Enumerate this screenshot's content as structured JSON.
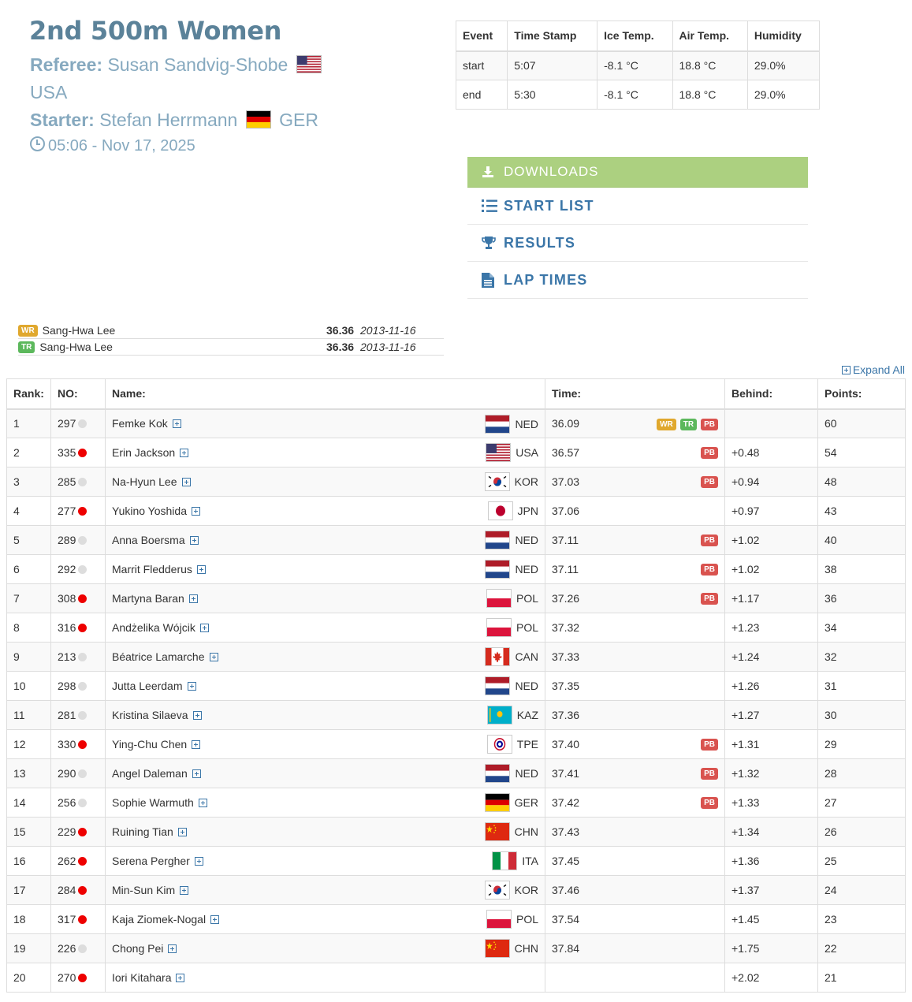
{
  "event": {
    "title": "2nd 500m Women",
    "referee_label": "Referee:",
    "referee_name": "Susan Sandvig-Shobe",
    "referee_country": "USA",
    "starter_label": "Starter:",
    "starter_name": "Stefan Herrmann",
    "starter_country": "GER",
    "datetime": "05:06 - Nov 17, 2025"
  },
  "conditions": {
    "headers": [
      "Event",
      "Time Stamp",
      "Ice Temp.",
      "Air Temp.",
      "Humidity"
    ],
    "rows": [
      [
        "start",
        "5:07",
        "-8.1 °C",
        "18.8 °C",
        "29.0%"
      ],
      [
        "end",
        "5:30",
        "-8.1 °C",
        "18.8 °C",
        "29.0%"
      ]
    ]
  },
  "downloads": {
    "title": "DOWNLOADS",
    "items": [
      {
        "label": "START LIST",
        "icon": "list-ol-icon"
      },
      {
        "label": "RESULTS",
        "icon": "trophy-icon"
      },
      {
        "label": "LAP TIMES",
        "icon": "document-icon"
      }
    ]
  },
  "records": [
    {
      "badge": "WR",
      "name": "Sang-Hwa Lee",
      "time": "36.36",
      "date": "2013-11-16"
    },
    {
      "badge": "TR",
      "name": "Sang-Hwa Lee",
      "time": "36.36",
      "date": "2013-11-16"
    }
  ],
  "expand_all_label": "Expand All",
  "results": {
    "headers": {
      "rank": "Rank:",
      "no": "NO:",
      "name": "Name:",
      "time": "Time:",
      "behind": "Behind:",
      "points": "Points:"
    },
    "rows": [
      {
        "rank": "1",
        "no": "297",
        "dot": "grey",
        "name": "Femke Kok",
        "nat": "NED",
        "time": "36.09",
        "badges": [
          "WR",
          "TR",
          "PB"
        ],
        "behind": "",
        "points": "60"
      },
      {
        "rank": "2",
        "no": "335",
        "dot": "red",
        "name": "Erin Jackson",
        "nat": "USA",
        "time": "36.57",
        "badges": [
          "PB"
        ],
        "behind": "+0.48",
        "points": "54"
      },
      {
        "rank": "3",
        "no": "285",
        "dot": "grey",
        "name": "Na-Hyun Lee",
        "nat": "KOR",
        "time": "37.03",
        "badges": [
          "PB"
        ],
        "behind": "+0.94",
        "points": "48"
      },
      {
        "rank": "4",
        "no": "277",
        "dot": "red",
        "name": "Yukino Yoshida",
        "nat": "JPN",
        "time": "37.06",
        "badges": [],
        "behind": "+0.97",
        "points": "43"
      },
      {
        "rank": "5",
        "no": "289",
        "dot": "grey",
        "name": "Anna Boersma",
        "nat": "NED",
        "time": "37.11",
        "badges": [
          "PB"
        ],
        "behind": "+1.02",
        "points": "40"
      },
      {
        "rank": "6",
        "no": "292",
        "dot": "grey",
        "name": "Marrit Fledderus",
        "nat": "NED",
        "time": "37.11",
        "badges": [
          "PB"
        ],
        "behind": "+1.02",
        "points": "38"
      },
      {
        "rank": "7",
        "no": "308",
        "dot": "red",
        "name": "Martyna Baran",
        "nat": "POL",
        "time": "37.26",
        "badges": [
          "PB"
        ],
        "behind": "+1.17",
        "points": "36"
      },
      {
        "rank": "8",
        "no": "316",
        "dot": "red",
        "name": "Andżelika Wójcik",
        "nat": "POL",
        "time": "37.32",
        "badges": [],
        "behind": "+1.23",
        "points": "34"
      },
      {
        "rank": "9",
        "no": "213",
        "dot": "grey",
        "name": "Béatrice Lamarche",
        "nat": "CAN",
        "time": "37.33",
        "badges": [],
        "behind": "+1.24",
        "points": "32"
      },
      {
        "rank": "10",
        "no": "298",
        "dot": "grey",
        "name": "Jutta Leerdam",
        "nat": "NED",
        "time": "37.35",
        "badges": [],
        "behind": "+1.26",
        "points": "31"
      },
      {
        "rank": "11",
        "no": "281",
        "dot": "grey",
        "name": "Kristina Silaeva",
        "nat": "KAZ",
        "time": "37.36",
        "badges": [],
        "behind": "+1.27",
        "points": "30"
      },
      {
        "rank": "12",
        "no": "330",
        "dot": "red",
        "name": "Ying-Chu Chen",
        "nat": "TPE",
        "time": "37.40",
        "badges": [
          "PB"
        ],
        "behind": "+1.31",
        "points": "29"
      },
      {
        "rank": "13",
        "no": "290",
        "dot": "grey",
        "name": "Angel Daleman",
        "nat": "NED",
        "time": "37.41",
        "badges": [
          "PB"
        ],
        "behind": "+1.32",
        "points": "28"
      },
      {
        "rank": "14",
        "no": "256",
        "dot": "grey",
        "name": "Sophie Warmuth",
        "nat": "GER",
        "time": "37.42",
        "badges": [
          "PB"
        ],
        "behind": "+1.33",
        "points": "27"
      },
      {
        "rank": "15",
        "no": "229",
        "dot": "red",
        "name": "Ruining Tian",
        "nat": "CHN",
        "time": "37.43",
        "badges": [],
        "behind": "+1.34",
        "points": "26"
      },
      {
        "rank": "16",
        "no": "262",
        "dot": "red",
        "name": "Serena Pergher",
        "nat": "ITA",
        "time": "37.45",
        "badges": [],
        "behind": "+1.36",
        "points": "25"
      },
      {
        "rank": "17",
        "no": "284",
        "dot": "red",
        "name": "Min-Sun Kim",
        "nat": "KOR",
        "time": "37.46",
        "badges": [],
        "behind": "+1.37",
        "points": "24"
      },
      {
        "rank": "18",
        "no": "317",
        "dot": "red",
        "name": "Kaja Ziomek-Nogal",
        "nat": "POL",
        "time": "37.54",
        "badges": [],
        "behind": "+1.45",
        "points": "23"
      },
      {
        "rank": "19",
        "no": "226",
        "dot": "grey",
        "name": "Chong Pei",
        "nat": "CHN",
        "time": "37.84",
        "badges": [],
        "behind": "+1.75",
        "points": "22"
      },
      {
        "rank": "20",
        "no": "270",
        "dot": "red",
        "name": "Iori Kitahara",
        "nat": "",
        "time": "",
        "badges": [],
        "behind": "+2.02",
        "points": "21"
      }
    ]
  },
  "colors": {
    "title": "#5b8299",
    "meta": "#86a9bf",
    "link": "#3b76a8",
    "downloads_header": "#acd080",
    "badge_wr": "#e0a82e",
    "badge_tr": "#5cb85c",
    "badge_pb": "#d9534f",
    "dot_red": "#ee0000",
    "dot_grey": "#dddddd"
  }
}
